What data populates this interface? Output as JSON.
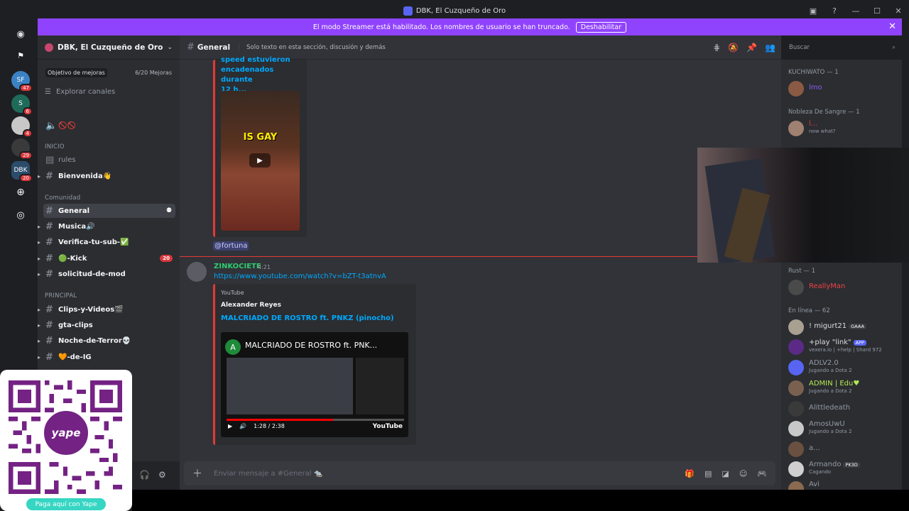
{
  "window": {
    "title": "DBK, El Cuzqueño de Oro"
  },
  "streamer_bar": {
    "text": "El modo Streamer está habilitado. Los nombres de usuario se han truncado.",
    "button": "Deshabilitar"
  },
  "guilds": [
    {
      "badge": "47"
    },
    {
      "badge": "6"
    },
    {
      "badge": "4"
    },
    {
      "badge": "29"
    },
    {
      "badge": "20"
    }
  ],
  "server": {
    "name": "DBK, El Cuzqueño de Oro",
    "boost_label": "Objetivo de mejoras",
    "boost_count": "6/20 Mejoras",
    "explore": "Explorar canales"
  },
  "categories": {
    "inicio": "INICIO",
    "comunidad": "Comunidad",
    "principal": "PRINCIPAL"
  },
  "channels": {
    "rules": "rules",
    "bienvenida": "Bienvenida👋",
    "general": "General",
    "musica": "Musica🔊",
    "verifica": "Verifica-tu-sub-✅",
    "kick": "🟢-Kick",
    "kick_count": "20",
    "solicitud": "solicitud-de-mod",
    "clips": "Clips-y-Videos🎬",
    "gta": "gta-clips",
    "noche": "Noche-de-Terror💀",
    "ig": "🧡-de-IG"
  },
  "header": {
    "channel": "General",
    "topic": "Solo texto en esta sección, discusión y demás",
    "search_placeholder": "Buscar"
  },
  "messages": {
    "prev_embed_text_1": "speed estuvieron",
    "prev_embed_text_2": "encadenados durante",
    "prev_embed_text_3": "12 h...",
    "video_caption": "IS GAY",
    "mention": "@fortuna",
    "author": "ZINKOCIETE",
    "time": "4:21",
    "link": "https://www.youtube.com/watch?v=bZT-t3atnvA",
    "embed": {
      "provider": "YouTube",
      "author": "Alexander Reyes",
      "title": "MALCRIADO DE ROSTRO ft. PNKZ (pinocho)",
      "thumb_title": "MALCRIADO DE ROSTRO ft. PNK...",
      "thumb_avatar": "A",
      "time": "1:28 / 2:38",
      "logo": "YouTube"
    }
  },
  "composer": {
    "placeholder": "Enviar mensaje a #General 🐀"
  },
  "members": {
    "cat1": "KUCHIWATO — 1",
    "m1": "lmo",
    "cat2": "Nobleza De Sangre — 1",
    "m2": "l...",
    "m2_status": "now what?",
    "cat3": "Rust — 1",
    "m3": "ReallyMan",
    "cat4": "En línea — 62",
    "list": [
      {
        "name": "! migurt21",
        "status": "",
        "tag": "GAAA"
      },
      {
        "name": "+play \"link\"",
        "status": "vexera.io | +help | Shard 972",
        "tag": "APP"
      },
      {
        "name": "ADLV2.0",
        "status": "Jugando a Dota 2",
        "tag": ""
      },
      {
        "name": "ADMIN | Edu♥",
        "status": "Jugando a Dota 2",
        "tag": ""
      },
      {
        "name": "Alittledeath",
        "status": "",
        "tag": ""
      },
      {
        "name": "AmosUwU",
        "status": "Jugando a Dota 2",
        "tag": ""
      },
      {
        "name": "a...",
        "status": "",
        "tag": ""
      },
      {
        "name": "Armando",
        "status": "Cagando",
        "tag": "PK3D"
      },
      {
        "name": "Avi",
        "status": "",
        "tag": ""
      }
    ]
  },
  "qr": {
    "button": "Paga aquí con Yape",
    "logo": "yape"
  },
  "colors": {
    "accent": "#5865f2",
    "streamer": "#9043fd",
    "new_marker": "#e53935",
    "link": "#00a8fc"
  }
}
